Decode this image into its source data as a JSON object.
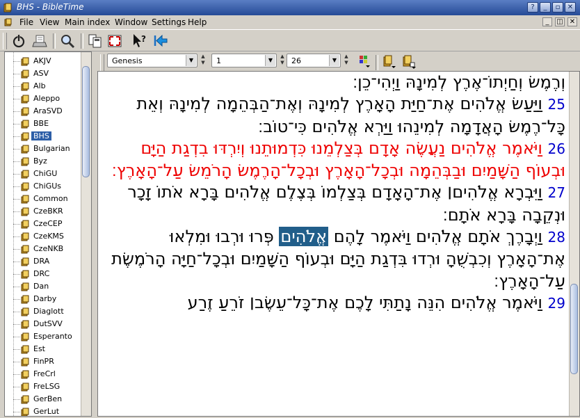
{
  "window": {
    "title": "BHS - BibleTime"
  },
  "menubar": {
    "items": [
      "File",
      "View",
      "Main index",
      "Window",
      "Settings",
      "Help"
    ]
  },
  "toolbar": {
    "icons": [
      "power-icon",
      "print-icon",
      "search-icon",
      "tile-icon",
      "fullscreen-icon",
      "whats-this-icon",
      "back-icon"
    ]
  },
  "modules": [
    "AKJV",
    "ASV",
    "Alb",
    "Aleppo",
    "AraSVD",
    "BBE",
    "BHS",
    "Bulgarian",
    "Byz",
    "ChiGU",
    "ChiGUs",
    "Common",
    "CzeBKR",
    "CzeCEP",
    "CzeKMS",
    "CzeNKB",
    "DRA",
    "DRC",
    "Dan",
    "Darby",
    "Diaglott",
    "DutSVV",
    "Esperanto",
    "Est",
    "FinPR",
    "FreCrl",
    "FreLSG",
    "GerBen",
    "GerLut"
  ],
  "selected_module": "BHS",
  "display": {
    "book": "Genesis",
    "chapter": "1",
    "verse": "26"
  },
  "text": {
    "verse24_tail": "וְרֶמֶשׂ וְחַיְתוֹ־אֶרֶץ לְמִינָהּ וַיְהִי־כֵן׃",
    "v25": {
      "num": "25",
      "text": "וַיַּעַשׂ אֱלֹהִים אֶת־חַיַּת הָאָרֶץ לְמִינָהּ וְאֶת־הַבְּהֵמָה לְמִינָהּ וְאֵת כָּל־רֶמֶשׂ הָאֲדָמָה לְמִינֵהוּ וַיַּרְא אֱלֹהִים כִּי־טוֹב׃"
    },
    "v26": {
      "num": "26",
      "text": "וַיֹּאמֶר אֱלֹהִים נַעֲשֶׂה אָדָם בְּצַלְמֵנוּ כִּדְמוּתֵנוּ וְיִרְדּוּ בִדְגַת הַיָּם וּבְעוֹף הַשָּׁמַיִם וּבַבְּהֵמָה וּבְכָל־הָאָרֶץ וּבְכָל־הָרֶמֶשׂ הָרֹמֵשׂ עַל־הָאָרֶץ׃"
    },
    "v27": {
      "num": "27",
      "text": "וַיִּבְרָא אֱלֹהִים׀ אֶת־הָאָדָם בְּצַלְמוֹ בְּצֶלֶם אֱלֹהִים בָּרָא אֹתוֹ זָכָר וּנְקֵבָה בָּרָא אֹתָם׃"
    },
    "v28": {
      "num": "28",
      "before": "וַיְבָרֶךְ אֹתָם אֱלֹהִים וַיֹּאמֶר לָהֶם",
      "highlight": "אֱלֹהִים",
      "after": "פְּרוּ וּרְבוּ וּמִלְאוּ אֶת־הָאָרֶץ וְכִבְשֻׁהָ וּרְדוּ בִּדְגַת הַיָּם וּבְעוֹף הַשָּׁמַיִם וּבְכָל־חַיָּה הָרֹמֶשֶׂת עַל־הָאָרֶץ׃"
    },
    "v29": {
      "num": "29",
      "text": "וַיֹּאמֶר אֱלֹהִים הִנֵּה נָתַתִּי לָכֶם אֶת־כָּל־עֵשֶׂב׀ זֹרֵעַ זֶרַע"
    }
  }
}
